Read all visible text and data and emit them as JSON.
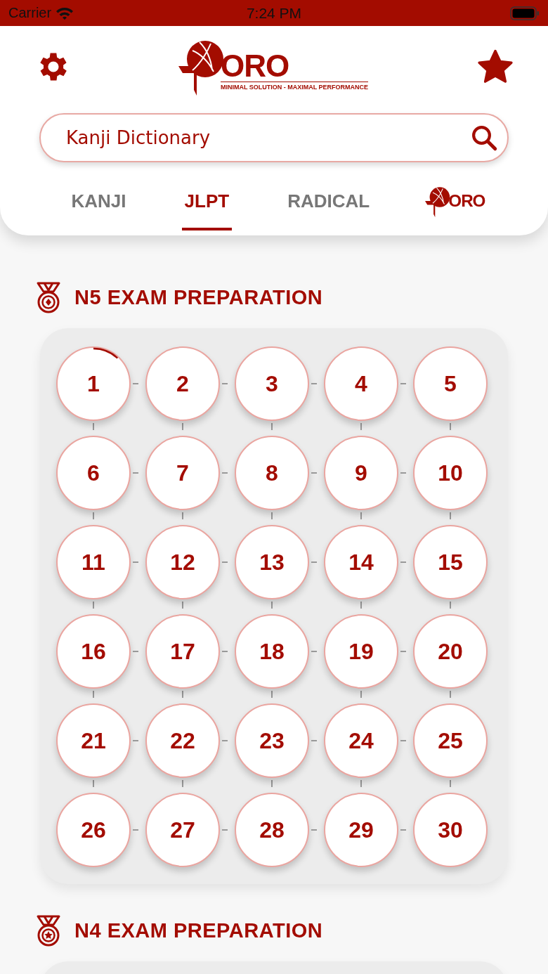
{
  "status_bar": {
    "carrier": "Carrier",
    "time": "7:24 PM"
  },
  "header": {
    "logo": {
      "mark": "ORO",
      "tagline": "MINIMAL SOLUTION - MAXIMAL PERFORMANCE"
    }
  },
  "search": {
    "value": "Kanji Dictionary"
  },
  "tabs": [
    {
      "kind": "text",
      "label": "KANJI",
      "selected": false
    },
    {
      "kind": "text",
      "label": "JLPT",
      "selected": true
    },
    {
      "kind": "text",
      "label": "RADICAL",
      "selected": false
    },
    {
      "kind": "logo",
      "label": "ORO",
      "selected": false
    }
  ],
  "sections": [
    {
      "title": "N5 EXAM PREPARATION",
      "lessons": [
        {
          "label": "1",
          "started": true
        },
        {
          "label": "2",
          "started": false
        },
        {
          "label": "3",
          "started": false
        },
        {
          "label": "4",
          "started": false
        },
        {
          "label": "5",
          "started": false
        },
        {
          "label": "6",
          "started": false
        },
        {
          "label": "7",
          "started": false
        },
        {
          "label": "8",
          "started": false
        },
        {
          "label": "9",
          "started": false
        },
        {
          "label": "10",
          "started": false
        },
        {
          "label": "11",
          "started": false
        },
        {
          "label": "12",
          "started": false
        },
        {
          "label": "13",
          "started": false
        },
        {
          "label": "14",
          "started": false
        },
        {
          "label": "15",
          "started": false
        },
        {
          "label": "16",
          "started": false
        },
        {
          "label": "17",
          "started": false
        },
        {
          "label": "18",
          "started": false
        },
        {
          "label": "19",
          "started": false
        },
        {
          "label": "20",
          "started": false
        },
        {
          "label": "21",
          "started": false
        },
        {
          "label": "22",
          "started": false
        },
        {
          "label": "23",
          "started": false
        },
        {
          "label": "24",
          "started": false
        },
        {
          "label": "25",
          "started": false
        },
        {
          "label": "26",
          "started": false
        },
        {
          "label": "27",
          "started": false
        },
        {
          "label": "28",
          "started": false
        },
        {
          "label": "29",
          "started": false
        },
        {
          "label": "30",
          "started": false
        }
      ]
    },
    {
      "title": "N4 EXAM PREPARATION"
    }
  ]
}
